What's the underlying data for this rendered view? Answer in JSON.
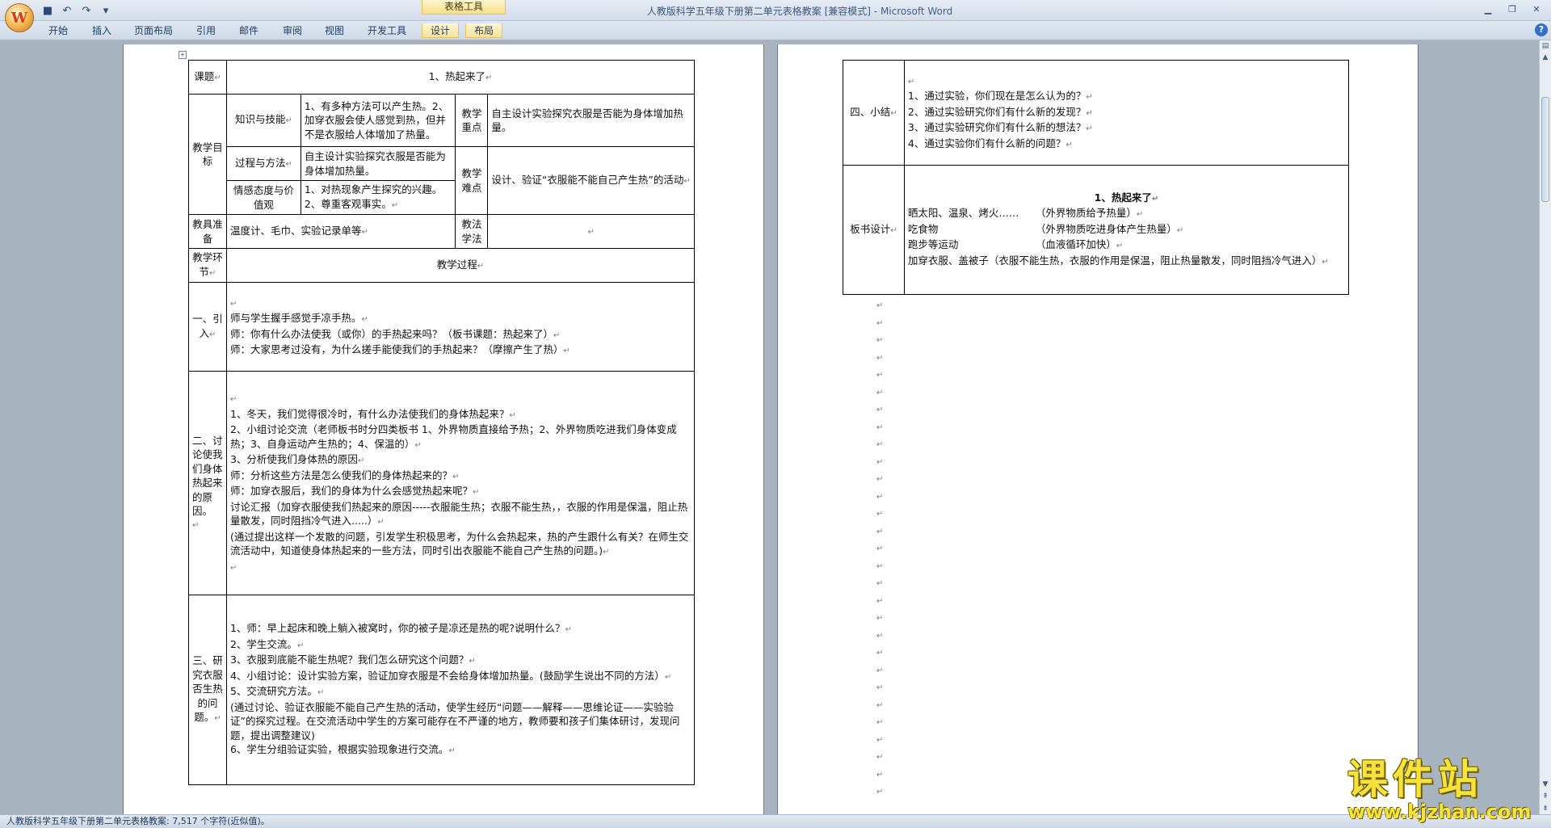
{
  "window": {
    "title": "人教版科学五年级下册第二单元表格教案 [兼容模式]",
    "app_name": "Microsoft Word",
    "separator": " - ",
    "contextual_group": "表格工具"
  },
  "qat": {
    "save_icon": "save-icon",
    "undo_icon": "undo-icon",
    "redo_icon": "redo-icon",
    "customize_icon": "dropdown-icon"
  },
  "ribbon": {
    "tabs": [
      "开始",
      "插入",
      "页面布局",
      "引用",
      "邮件",
      "审阅",
      "视图",
      "开发工具",
      "设计",
      "布局"
    ]
  },
  "para_mark": "↵",
  "table1": {
    "course_label": "课题",
    "course_title": "1、热起来了",
    "goals_label": "教学目标",
    "knowledge_label": "知识与技能",
    "knowledge_text": "1、有多种方法可以产生热。2、加穿衣服会使人感觉到热，但并不是衣服给人体增加了热量。",
    "key_label": "教学重点",
    "key_text": "自主设计实验探究衣服是否能为身体增加热量。",
    "process_label": "过程与方法",
    "process_text": "自主设计实验探究衣服是否能为身体增加热量。",
    "difficulty_label": "教学难点",
    "difficulty_text": "设计、验证“衣服能不能自己产生热”的活动",
    "emotion_label": "情感态度与价值观",
    "emotion_text": "1、对热现象产生探究的兴趣。     2、尊重客观事实。",
    "tools_label": "教具准备",
    "tools_text": "温度计、毛巾、实验记录单等",
    "method_label": "教法学法",
    "method_text": "",
    "stage_header": "教学环节",
    "process_header": "教学过程",
    "stages": [
      {
        "name": "一、引入",
        "lines": [
          "",
          "师与学生握手感觉手凉手热。",
          "师：你有什么办法使我（或你）的手热起来吗？（板书课题：热起来了）",
          "师：大家思考过没有，为什么搓手能使我们的手热起来？（摩擦产生了热）"
        ]
      },
      {
        "name": "二、讨论使我们身体热起来的原因。",
        "lines": [
          "",
          "1、冬天，我们觉得很冷时，有什么办法使我们的身体热起来？",
          "2、小组讨论交流（老师板书时分四类板书 1、外界物质直接给予热；2、外界物质吃进我们身体变成热；3、自身运动产生热的；4、保温的）",
          "3、分析使我们身体热的原因",
          "师：分析这些方法是怎么使我们的身体热起来的？",
          "师：加穿衣服后，我们的身体为什么会感觉热起来呢？",
          "讨论汇报（加穿衣服使我们热起来的原因-----衣服能生热；衣服不能生热，，衣服的作用是保温，阻止热量散发，同时阻挡冷气进入.....）",
          "(通过提出这样一个发散的问题，引发学生积极思考，为什么会热起来，热的产生跟什么有关？在师生交流活动中，知道使身体热起来的一些方法，同时引出衣服能不能自己产生热的问题。)",
          ""
        ]
      },
      {
        "name": "三、研究衣服否生热的问题。",
        "lines": [
          "1、师：早上起床和晚上躺入被窝时，你的被子是凉还是热的呢?说明什么？",
          "2、学生交流。",
          "3、衣服到底能不能生热呢？我们怎么研究这个问题？",
          "4、小组讨论：设计实验方案，验证加穿衣服是不会给身体增加热量。(鼓励学生说出不同的方法）",
          "5、交流研究方法。",
          "(通过讨论、验证衣服能不能自己产生热的活动，使学生经历“问题——解释——思维论证——实验验证”的探究过程。在交流活动中学生的方案可能存在不严谨的地方，教师要和孩子们集体研讨，发现问题，提出调整建议)",
          "6、学生分组验证实验，根据实验现象进行交流。"
        ]
      }
    ]
  },
  "table2": {
    "summary_label": "四、小结",
    "summary_lines": [
      "",
      "1、通过实验，你们现在是怎么认为的？",
      "2、通过实验研究你们有什么新的发现？",
      "3、通过实验研究你们有什么新的想法？",
      "4、通过实验你们有什么新的问题？"
    ],
    "board_label": "板书设计",
    "board_title": "1、热起来了",
    "board_rows": [
      {
        "left": "晒太阳、温泉、烤火……",
        "right": "（外界物质给予热量）"
      },
      {
        "left": "吃食物",
        "right": "（外界物质吃进身体产生热量）"
      },
      {
        "left": "跑步等运动",
        "right": "（血液循环加快）"
      }
    ],
    "board_last": "加穿衣服、盖被子（衣服不能生热，衣服的作用是保温，阻止热量散发，同时阻挡冷气进入）"
  },
  "statusbar": {
    "text": "人教版科学五年级下册第二单元表格教案: 7,517 个字符(近似值)。"
  },
  "watermark": {
    "big": "课件站",
    "url": "www.kjzhan.com"
  }
}
